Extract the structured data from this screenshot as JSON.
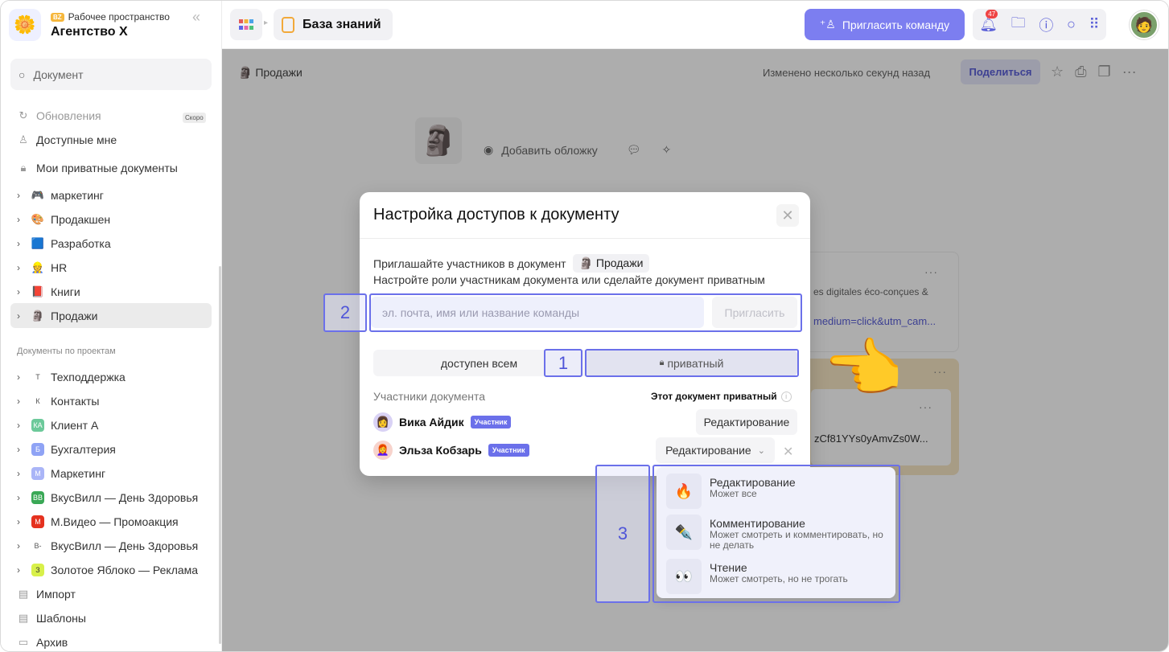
{
  "workspace": {
    "badge": "BZ",
    "label": "Рабочее пространство",
    "name": "Агентство X",
    "logo": "🌼"
  },
  "search": {
    "placeholder": "Документ"
  },
  "sidebar": {
    "updates": "Обновления",
    "soon": "Скоро",
    "shared": "Доступные мне",
    "private": "Мои приватные документы",
    "spaces": [
      {
        "label": "маркетинг",
        "icon": "🎮",
        "color": "#ffffff"
      },
      {
        "label": "Продакшен",
        "icon": "🎨",
        "color": "#ffffff"
      },
      {
        "label": "Разработка",
        "icon": "🟦",
        "color": "#ffffff"
      },
      {
        "label": "HR",
        "icon": "👷",
        "color": "#ffffff"
      },
      {
        "label": "Книги",
        "icon": "📕",
        "color": "#ffffff"
      },
      {
        "label": "Продажи",
        "icon": "🗿",
        "color": "#ffffff"
      }
    ],
    "projects_title": "Документы по проектам",
    "projects": [
      {
        "label": "Техподдержка",
        "badge": "Т",
        "color": "#ffffff",
        "fg": "#555"
      },
      {
        "label": "Контакты",
        "badge": "К",
        "color": "#ffffff",
        "fg": "#555"
      },
      {
        "label": "Клиент А",
        "badge": "КА",
        "color": "#6cc99a",
        "fg": "#fff"
      },
      {
        "label": "Бухгалтерия",
        "badge": "Б",
        "color": "#8fa3f5",
        "fg": "#fff"
      },
      {
        "label": "Маркетинг",
        "badge": "М",
        "color": "#aab5f7",
        "fg": "#fff"
      },
      {
        "label": "ВкусВилл — День Здоровья",
        "badge": "ВВ",
        "color": "#3aa856",
        "fg": "#fff"
      },
      {
        "label": "М.Видео — Промоакция",
        "badge": "М",
        "color": "#e5321f",
        "fg": "#fff"
      },
      {
        "label": "ВкусВилл — День Здоровья",
        "badge": "В-",
        "color": "#ffffff",
        "fg": "#555"
      },
      {
        "label": "Золотое Яблоко — Реклама",
        "badge": "З",
        "color": "#d8f04a",
        "fg": "#333"
      }
    ],
    "import": "Импорт",
    "templates": "Шаблоны",
    "archive": "Архив"
  },
  "topbar": {
    "breadcrumb": "База знаний",
    "invite_team": "Пригласить команду",
    "notif_count": "47"
  },
  "doc": {
    "crumb": "🗿 Продажи",
    "changed": "Изменено несколько секунд назад",
    "share": "Поделиться",
    "add_cover": "Добавить обложку",
    "card1_text": "es digitales éco-conçues &",
    "card1_link": "medium=click&utm_cam...",
    "card2_text": "zCf81YYs0yAmvZs0W..."
  },
  "modal": {
    "title": "Настройка доступов к документу",
    "invite_line": "Приглашайте участников в документ",
    "doc_chip": "🗿 Продажи",
    "roles_line": "Настройте роли участникам документа или сделайте документ приватным",
    "input_placeholder": "эл. почта, имя или название команды",
    "invite_button": "Пригласить",
    "toggle_all": "доступен всем",
    "toggle_private": "приватный",
    "members_title": "Участники документа",
    "private_note": "Этот документ приватный",
    "members": [
      {
        "name": "Вика Айдик",
        "role_badge": "Участник",
        "role": "Редактирование",
        "avatar": "👩"
      },
      {
        "name": "Эльза Кобзарь",
        "role_badge": "Участник",
        "role": "Редактирование",
        "avatar": "👩‍🦰"
      }
    ]
  },
  "dropdown": [
    {
      "title": "Редактирование",
      "sub": "Может все",
      "icon": "🔥"
    },
    {
      "title": "Комментирование",
      "sub": "Может смотреть и комментировать, но не делать",
      "icon": "✒️"
    },
    {
      "title": "Чтение",
      "sub": "Может смотреть, но не трогать",
      "icon": "👀"
    }
  ],
  "callouts": {
    "one": "1",
    "two": "2",
    "three": "3"
  }
}
